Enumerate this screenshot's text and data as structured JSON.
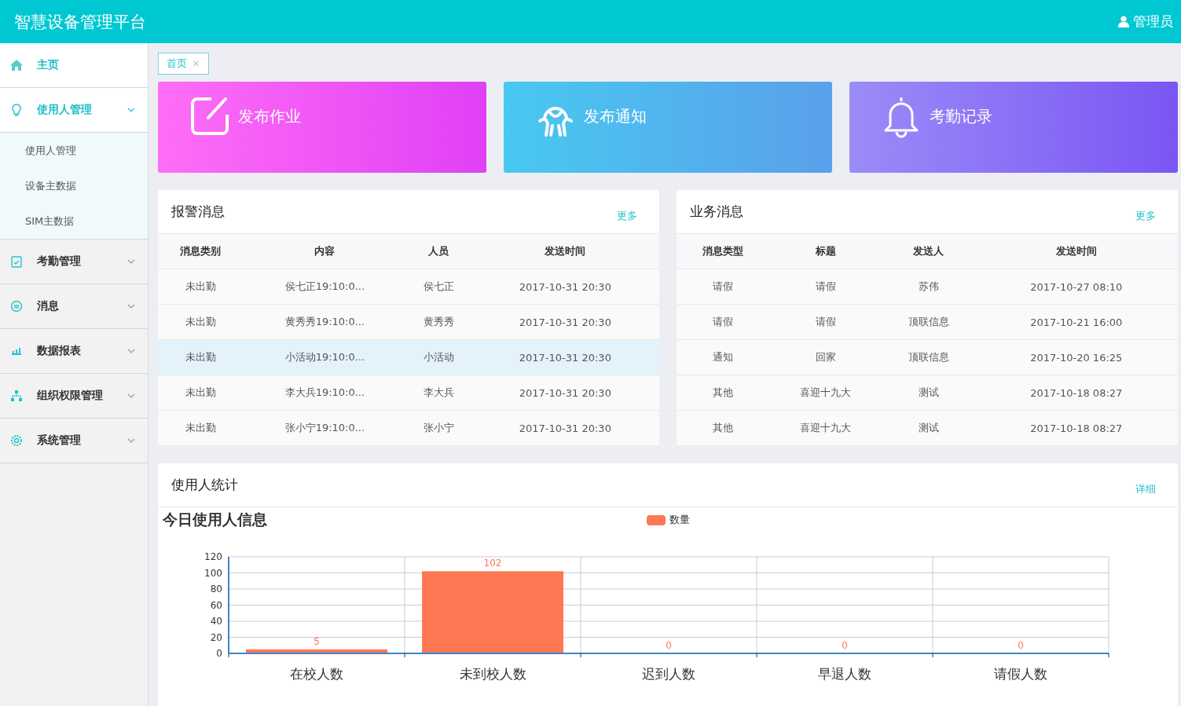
{
  "header": {
    "title": "智慧设备管理平台",
    "user": "管理员"
  },
  "sidebar": {
    "items": [
      {
        "label": "主页",
        "selected": true
      },
      {
        "label": "使用人管理",
        "selected": true,
        "expanded": true,
        "children": [
          {
            "label": "使用人管理"
          },
          {
            "label": "设备主数据"
          },
          {
            "label": "SIM主数据"
          }
        ]
      },
      {
        "label": "考勤管理",
        "selected": false,
        "expanded": false
      },
      {
        "label": "消息",
        "selected": false,
        "expanded": false
      },
      {
        "label": "数据报表",
        "selected": false,
        "expanded": false
      },
      {
        "label": "组织权限管理",
        "selected": false,
        "expanded": false
      },
      {
        "label": "系统管理",
        "selected": false,
        "expanded": false
      }
    ]
  },
  "tabs": [
    {
      "label": "首页",
      "close": "×",
      "selected": true
    }
  ],
  "shortcuts": [
    {
      "label": "发布作业"
    },
    {
      "label": "发布通知"
    },
    {
      "label": "考勤记录"
    }
  ],
  "alarm_panel": {
    "title": "报警消息",
    "more": "更多",
    "columns": [
      "消息类别",
      "内容",
      "人员",
      "发送时间"
    ],
    "rows": [
      {
        "cells": [
          "未出勤",
          "侯七正19:10:0...",
          "侯七正",
          "2017-10-31 20:30"
        ],
        "selected": false
      },
      {
        "cells": [
          "未出勤",
          "黄秀秀19:10:0...",
          "黄秀秀",
          "2017-10-31 20:30"
        ],
        "selected": false
      },
      {
        "cells": [
          "未出勤",
          "小活动19:10:0...",
          "小活动",
          "2017-10-31 20:30"
        ],
        "selected": true
      },
      {
        "cells": [
          "未出勤",
          "李大兵19:10:0...",
          "李大兵",
          "2017-10-31 20:30"
        ],
        "selected": false
      },
      {
        "cells": [
          "未出勤",
          "张小宁19:10:0...",
          "张小宁",
          "2017-10-31 20:30"
        ],
        "selected": false
      }
    ]
  },
  "business_panel": {
    "title": "业务消息",
    "more": "更多",
    "columns": [
      "消息类型",
      "标题",
      "发送人",
      "发送时间"
    ],
    "rows": [
      {
        "cells": [
          "请假",
          "请假",
          "苏伟",
          "2017-10-27 08:10"
        ],
        "selected": false
      },
      {
        "cells": [
          "请假",
          "请假",
          "顶联信息",
          "2017-10-21 16:00"
        ],
        "selected": false
      },
      {
        "cells": [
          "通知",
          "回家",
          "顶联信息",
          "2017-10-20 16:25"
        ],
        "selected": false
      },
      {
        "cells": [
          "其他",
          "喜迎十九大",
          "测试",
          "2017-10-18 08:27"
        ],
        "selected": false
      },
      {
        "cells": [
          "其他",
          "喜迎十九大",
          "测试",
          "2017-10-18 08:27"
        ],
        "selected": false
      }
    ]
  },
  "stats_panel": {
    "title": "使用人统计",
    "detail": "详细",
    "chart_data": {
      "type": "bar",
      "title": "今日使用人信息",
      "categories": [
        "在校人数",
        "未到校人数",
        "迟到人数",
        "早退人数",
        "请假人数"
      ],
      "series": [
        {
          "name": "数量",
          "color": "#ff7854",
          "values": [
            5,
            102,
            0,
            0,
            0
          ]
        }
      ],
      "ylim": [
        0,
        120
      ],
      "yticks": [
        0,
        20,
        40,
        60,
        80,
        100,
        120
      ],
      "grid": true,
      "data_labels": true
    }
  }
}
